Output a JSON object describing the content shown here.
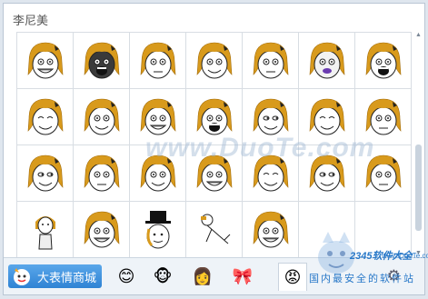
{
  "panel": {
    "title": "李尼美"
  },
  "faces": [
    {
      "exp": "grin",
      "teeth": true
    },
    {
      "exp": "rage",
      "dark": true
    },
    {
      "exp": "stare"
    },
    {
      "exp": "smirk"
    },
    {
      "exp": "meh"
    },
    {
      "exp": "smile",
      "purple": true
    },
    {
      "exp": "scream"
    },
    {
      "exp": "happy"
    },
    {
      "exp": "sweat"
    },
    {
      "exp": "grimace"
    },
    {
      "exp": "fuu"
    },
    {
      "exp": "sideeye"
    },
    {
      "exp": "laugh"
    },
    {
      "exp": "stare"
    },
    {
      "exp": "sly"
    },
    {
      "exp": "old"
    },
    {
      "exp": "ohyou"
    },
    {
      "exp": "trollish"
    },
    {
      "exp": "closed"
    },
    {
      "exp": "smug"
    },
    {
      "exp": "meh"
    },
    {
      "exp": "standing"
    },
    {
      "exp": "grin",
      "teeth": true
    },
    {
      "exp": "tophat"
    },
    {
      "exp": "lineart"
    },
    {
      "exp": "bigteeth"
    },
    {
      "exp": "empty"
    },
    {
      "exp": "empty"
    }
  ],
  "bottom_bar": {
    "shop_label": "大表情商城",
    "tabs": [
      {
        "name": "emoji-smiley-tab",
        "glyph": "😊"
      },
      {
        "name": "monkey-tab",
        "glyph": "🐵"
      },
      {
        "name": "girl-doodle-tab",
        "glyph": "👩"
      },
      {
        "name": "cartoon-tab",
        "glyph": "🎀"
      },
      {
        "name": "rage-face-tab",
        "glyph": "😡"
      }
    ]
  },
  "watermarks": {
    "center": "www.DuoTe.com",
    "site_brand": "2345软件大全",
    "site_domain": "www.DuoTe.com",
    "slogan": "国内最安全的软件站"
  }
}
